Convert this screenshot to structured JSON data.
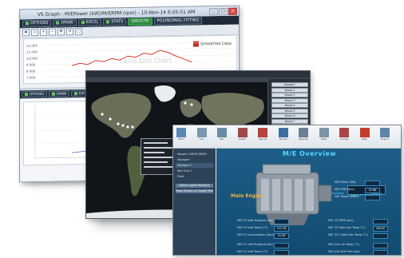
{
  "colors": {
    "trend_line": "#d93a2a",
    "map_marker": "#ffffff",
    "overview_title": "#56d7ff"
  },
  "window1": {
    "title": "VS Graph - M/EPower (kW)/M/ERPM (rpm) - 10-Nov-14 6:05:51 AM",
    "controls": [
      "_",
      "□",
      "x"
    ],
    "toolbar": [
      {
        "label": "OPTIONS",
        "style": "dot"
      },
      {
        "label": "DRAW",
        "style": "dot"
      },
      {
        "label": "EXCEL",
        "style": "dot"
      },
      {
        "label": "STATS",
        "style": "dot"
      },
      {
        "label": "SMOOTH",
        "style": "green"
      },
      {
        "label": "POLYNOMIAL FITTING",
        "style": "plain"
      }
    ],
    "legend_label": "Smoothed Data",
    "watermark": "Laros DAS Chart",
    "y_ticks": [
      "12.000",
      "11.000",
      "10.000",
      "9.000",
      "8.000",
      "7.000"
    ],
    "trend": [
      0.35,
      0.42,
      0.38,
      0.5,
      0.46,
      0.55,
      0.5,
      0.62,
      0.58,
      0.7,
      0.66,
      0.78,
      0.72,
      0.6,
      0.5,
      0.4
    ]
  },
  "window2": {
    "vessels": [
      "Voyager I",
      "Vessel 1",
      "Vessel 2",
      "Vessel 3",
      "Vessel 4",
      "Vessel 5",
      "Vessel 6",
      "Vessel 7",
      "Vessel 8",
      "Vessel 9",
      "Vessel 10",
      "Vessel 11",
      "Vessel 12",
      "Vessel 13"
    ]
  },
  "window3": {
    "title": "M/E Overview",
    "engine_label": "Main Engine",
    "ribbon": [
      "Main",
      "Aux",
      "Gen",
      "Graph",
      "Alarms",
      "Trends",
      "Reports",
      "Data",
      "Config",
      "Help",
      "Export"
    ],
    "left_rows": [
      "Vessel: LAROS DEMO",
      "Voyager I",
      "Voyager II",
      "Sea Trial 1",
      "Fleet"
    ],
    "left_buttons": [
      "Select Custom Positions",
      "Show Position on Google Map"
    ],
    "readings_top": [
      {
        "label": "M/E Power (kW)",
        "value": ""
      },
      {
        "label": "M/E RPM (rpm)",
        "value": "97.88"
      },
      {
        "label": "M/E Torque (kNm)",
        "value": ""
      }
    ],
    "readings_left": [
      {
        "label": "M/E FO Inlet Pressure (bar)",
        "value": ""
      },
      {
        "label": "M/E FO Inlet Temp (°C)",
        "value": "131.78"
      },
      {
        "label": "M/E FO Consumption (lt/min)",
        "value": "31.56"
      },
      {
        "label": "M/E LO Inlet Pressure (bar)",
        "value": ""
      },
      {
        "label": "M/E LO Inlet Temp (°C)",
        "value": ""
      }
    ],
    "readings_right": [
      {
        "label": "M/E T/C RPM (rpm)",
        "value": ""
      },
      {
        "label": "M/E T/C Inlet Gas Temp (°C)",
        "value": "400.00"
      },
      {
        "label": "M/E T/C Outlet Gas Temp (°C)",
        "value": ""
      },
      {
        "label": "M/E Scav Air Temp (°C)",
        "value": ""
      },
      {
        "label": "M/E JCW Inlet Pres (bar)",
        "value": ""
      }
    ]
  }
}
